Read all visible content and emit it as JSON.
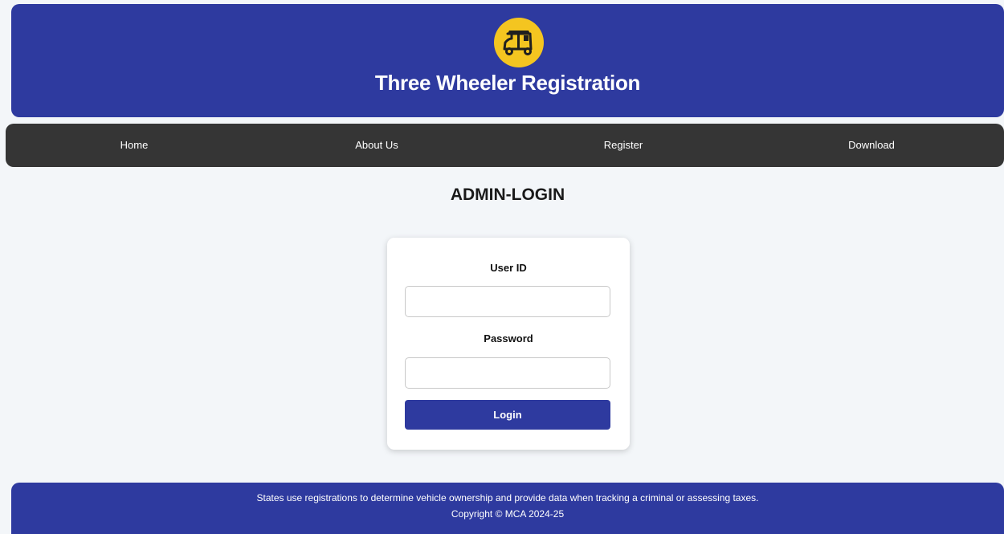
{
  "header": {
    "title": "Three Wheeler Registration",
    "logo_icon": "auto-rickshaw-icon",
    "background": "#2e3a9f",
    "logo_color": "#f4c520"
  },
  "nav": {
    "items": [
      {
        "label": "Home"
      },
      {
        "label": "About Us"
      },
      {
        "label": "Register"
      },
      {
        "label": "Download"
      }
    ],
    "background": "#353535"
  },
  "main": {
    "title": "ADMIN-LOGIN"
  },
  "login_form": {
    "user_id_label": "User ID",
    "user_id_value": "",
    "password_label": "Password",
    "password_value": "",
    "submit_label": "Login",
    "button_color": "#2e3a9f"
  },
  "footer": {
    "description": "States use registrations to determine vehicle ownership and provide data when tracking a criminal or assessing taxes.",
    "copyright": "Copyright © MCA 2024-25"
  }
}
